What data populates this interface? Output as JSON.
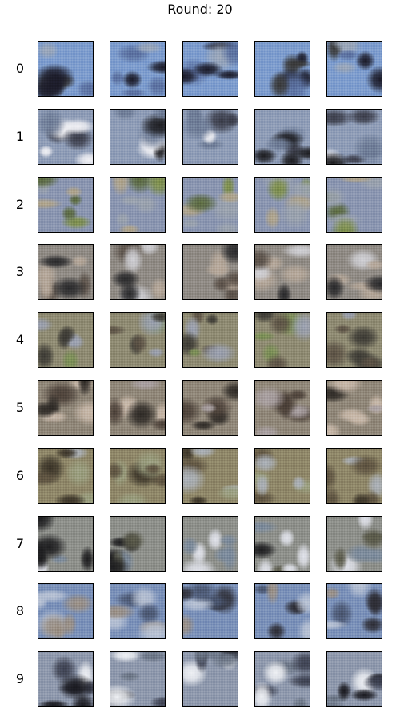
{
  "figure": {
    "title": "Round: 20"
  },
  "rows": [
    {
      "label": "0",
      "theme": {
        "bg": "#7d9ccd",
        "blobs": [
          "#3a3a3a",
          "#5a6f9e",
          "#1c1c2a",
          "#9aa6b8"
        ]
      }
    },
    {
      "label": "1",
      "theme": {
        "bg": "#8e9cb6",
        "blobs": [
          "#1e1e22",
          "#f0f0f4",
          "#3b3d4a",
          "#6e7c96"
        ]
      }
    },
    {
      "label": "2",
      "theme": {
        "bg": "#8a95b0",
        "blobs": [
          "#7e8f4a",
          "#9aa2ad",
          "#5b6a3f",
          "#b0a48a"
        ]
      }
    },
    {
      "label": "3",
      "theme": {
        "bg": "#8f8a84",
        "blobs": [
          "#2a2a2c",
          "#cfcfd4",
          "#5a5048",
          "#b6a89a"
        ]
      }
    },
    {
      "label": "4",
      "theme": {
        "bg": "#8e8a72",
        "blobs": [
          "#3d3b35",
          "#7a8f55",
          "#9aa0b0",
          "#5d5346"
        ]
      }
    },
    {
      "label": "5",
      "theme": {
        "bg": "#8f8678",
        "blobs": [
          "#2e2a26",
          "#a9a0a2",
          "#4b4038",
          "#c9b9aa"
        ]
      }
    },
    {
      "label": "6",
      "theme": {
        "bg": "#8e8668",
        "blobs": [
          "#3b3428",
          "#9a9f80",
          "#5d5240",
          "#aab0b8"
        ]
      }
    },
    {
      "label": "7",
      "theme": {
        "bg": "#8d8f8a",
        "blobs": [
          "#1e1e20",
          "#e0e2ea",
          "#5a5a4a",
          "#7b8a9c"
        ]
      }
    },
    {
      "label": "8",
      "theme": {
        "bg": "#7a90b8",
        "blobs": [
          "#2e2e36",
          "#b8c2d4",
          "#4a5670",
          "#9a8f84"
        ]
      }
    },
    {
      "label": "9",
      "theme": {
        "bg": "#8e98ac",
        "blobs": [
          "#1a1a20",
          "#eef0f4",
          "#3c4050",
          "#6a7484"
        ]
      }
    }
  ]
}
